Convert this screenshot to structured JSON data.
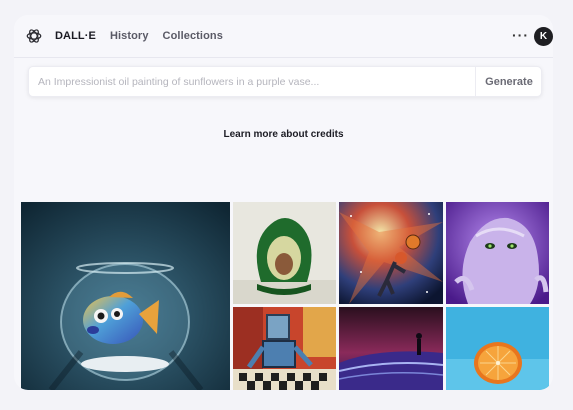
{
  "header": {
    "logo_icon": "openai-logo-icon",
    "nav": [
      "DALL·E",
      "History",
      "Collections"
    ],
    "more_icon": "more-dots-icon",
    "more_label": "···",
    "avatar_initial": "K"
  },
  "prompt": {
    "placeholder": "An Impressionist oil painting of sunflowers in a purple vase...",
    "value": "",
    "generate_label": "Generate"
  },
  "credits_link": "Learn more about credits",
  "gallery": {
    "items": [
      "goldfish-in-bowl-image",
      "avocado-armchair-image",
      "cosmic-basketball-player-image",
      "purple-furry-monster-image",
      "robot-playing-chess-image",
      "figure-in-purple-desert-image",
      "orange-half-on-blue-image"
    ]
  },
  "colors": {
    "page_bg": "#f3f3f8",
    "card_bg": "#f7f7fb",
    "avatar_bg": "#1e1e22"
  }
}
